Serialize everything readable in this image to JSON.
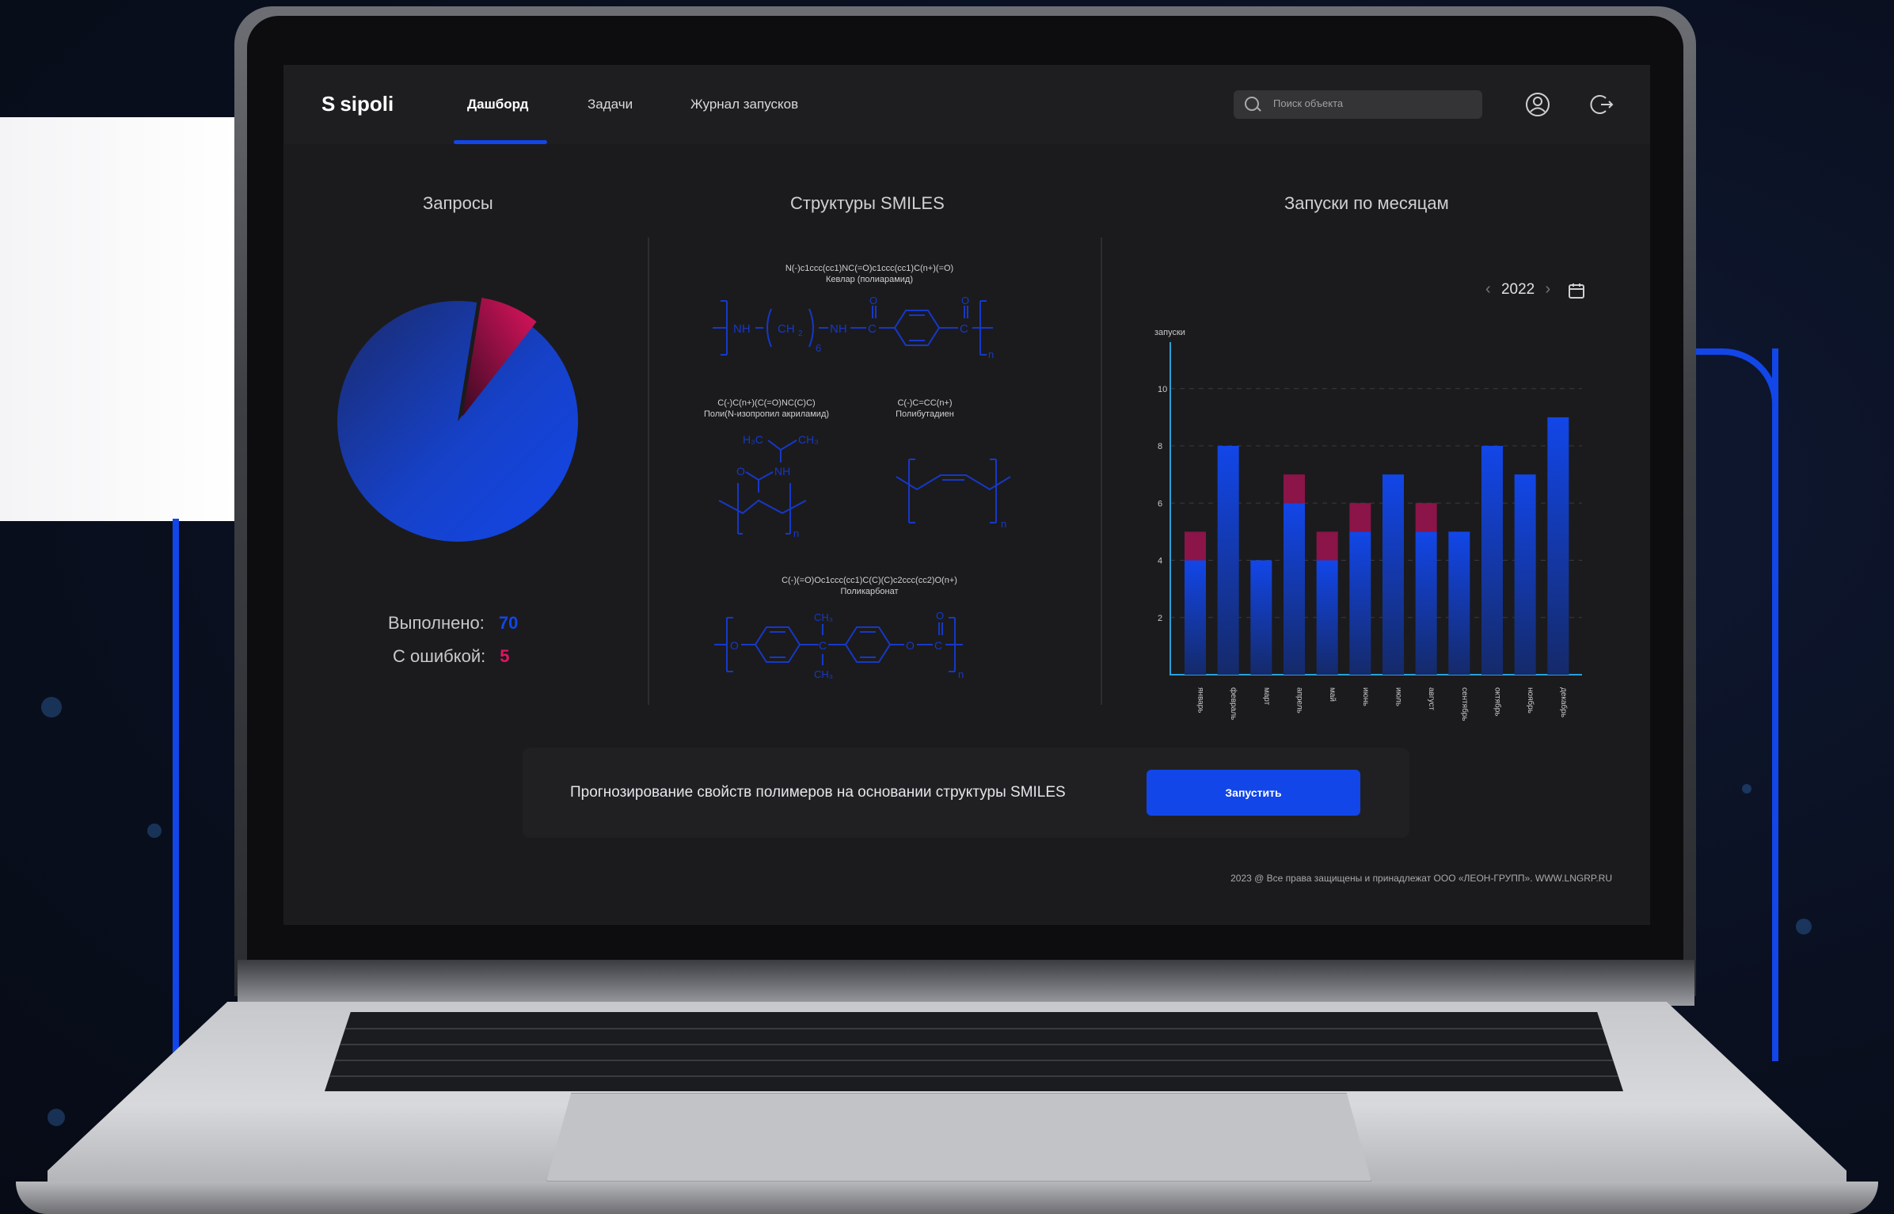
{
  "app": {
    "logo": "sipoli",
    "nav": [
      {
        "label": "Дашборд",
        "active": true
      },
      {
        "label": "Задачи",
        "active": false
      },
      {
        "label": "Журнал запусков",
        "active": false
      }
    ],
    "search_placeholder": "Поиск объекта",
    "icons": [
      "search-icon",
      "user-icon",
      "logout-icon"
    ]
  },
  "requests": {
    "title": "Запросы",
    "done_label": "Выполнено:",
    "done_value": "70",
    "error_label": "С ошибкой:",
    "error_value": "5",
    "done_color": "#1246e8",
    "error_color": "#e0145f"
  },
  "smiles": {
    "title": "Структуры SMILES",
    "items": [
      {
        "code": "N(-)c1ccc(cc1)NC(=O)c1ccc(cc1)C(n+)(=O)",
        "name": "Кевлар (полиарамид)"
      },
      {
        "code": "C(-)C(n+)(C(=O)NC(C)C)",
        "name": "Поли(N-изопропил акриламид)"
      },
      {
        "code": "C(-)C=CC(n+)",
        "name": "Полибутадиен"
      },
      {
        "code": "C(-)(=O)Oc1ccc(cc1)C(C)(C)c2ccc(cc2)O(n+)",
        "name": "Поликарбонат"
      }
    ]
  },
  "launches": {
    "title": "Запуски по месяцам",
    "year": "2022",
    "ylabel": "запуски"
  },
  "chart_data": {
    "type": "bar",
    "title": "Запуски по месяцам",
    "ylabel": "запуски",
    "ylim": [
      0,
      10
    ],
    "yticks": [
      2,
      4,
      6,
      8,
      10
    ],
    "categories": [
      "январь",
      "февраль",
      "март",
      "апрель",
      "май",
      "июнь",
      "июль",
      "август",
      "сентябрь",
      "октябрь",
      "ноябрь",
      "декабрь"
    ],
    "series": [
      {
        "color": "#1246e8",
        "values": [
          4,
          8,
          4,
          6,
          4,
          5,
          7,
          5,
          5,
          8,
          7,
          9
        ]
      },
      {
        "color": "#8b1448",
        "values": [
          1,
          0,
          0,
          1,
          1,
          1,
          0,
          1,
          0,
          0,
          0,
          0
        ]
      }
    ]
  },
  "pie_data": {
    "done": 70,
    "error": 5
  },
  "bottom": {
    "text": "Прогнозирование свойств полимеров на основании структуры SMILES",
    "button": "Запустить"
  },
  "footer": "2023 @ Все права защищены и принадлежат ООО «ЛЕОН-ГРУПП». WWW.LNGRP.RU"
}
